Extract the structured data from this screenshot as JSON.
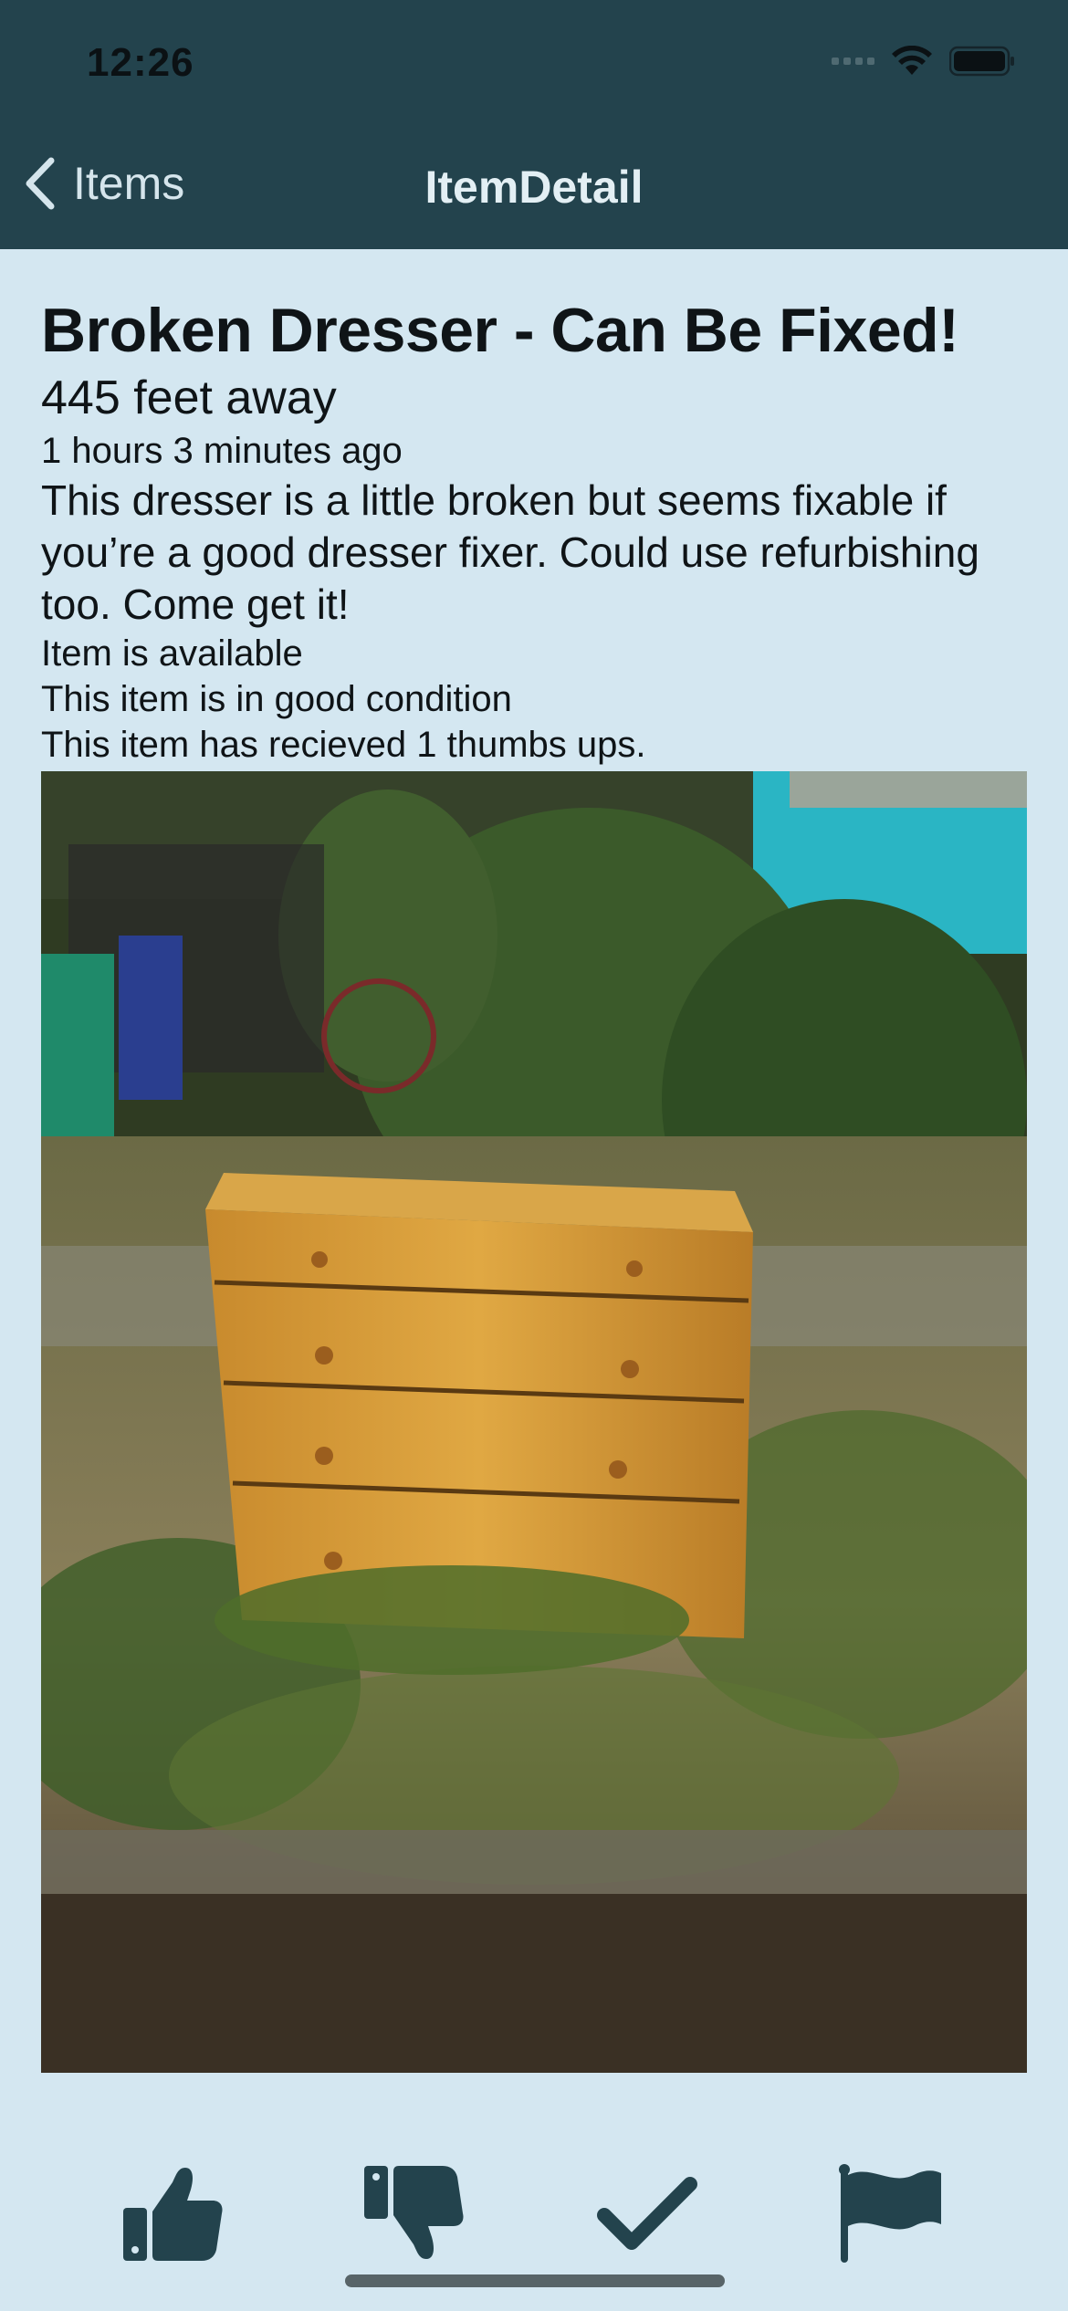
{
  "status_bar": {
    "time": "12:26"
  },
  "nav": {
    "back_label": "Items",
    "title": "ItemDetail"
  },
  "item": {
    "title": "Broken Dresser - Can Be Fixed!",
    "distance": "445 feet away",
    "posted": "1 hours 3 minutes ago",
    "description": "This dresser is a little broken but seems fixable if you’re a good dresser fixer. Could use refurbishing too. Come get it!",
    "availability": "Item is available",
    "condition": "This item is in good condition",
    "thumbs": "This item has recieved 1 thumbs ups."
  },
  "actions": [
    {
      "icon": "thumbs-up-icon"
    },
    {
      "icon": "thumbs-down-icon"
    },
    {
      "icon": "checkmark-icon"
    },
    {
      "icon": "flag-icon"
    }
  ],
  "colors": {
    "header": "#23434d",
    "background": "#d4e7f1",
    "icon": "#23434d"
  }
}
